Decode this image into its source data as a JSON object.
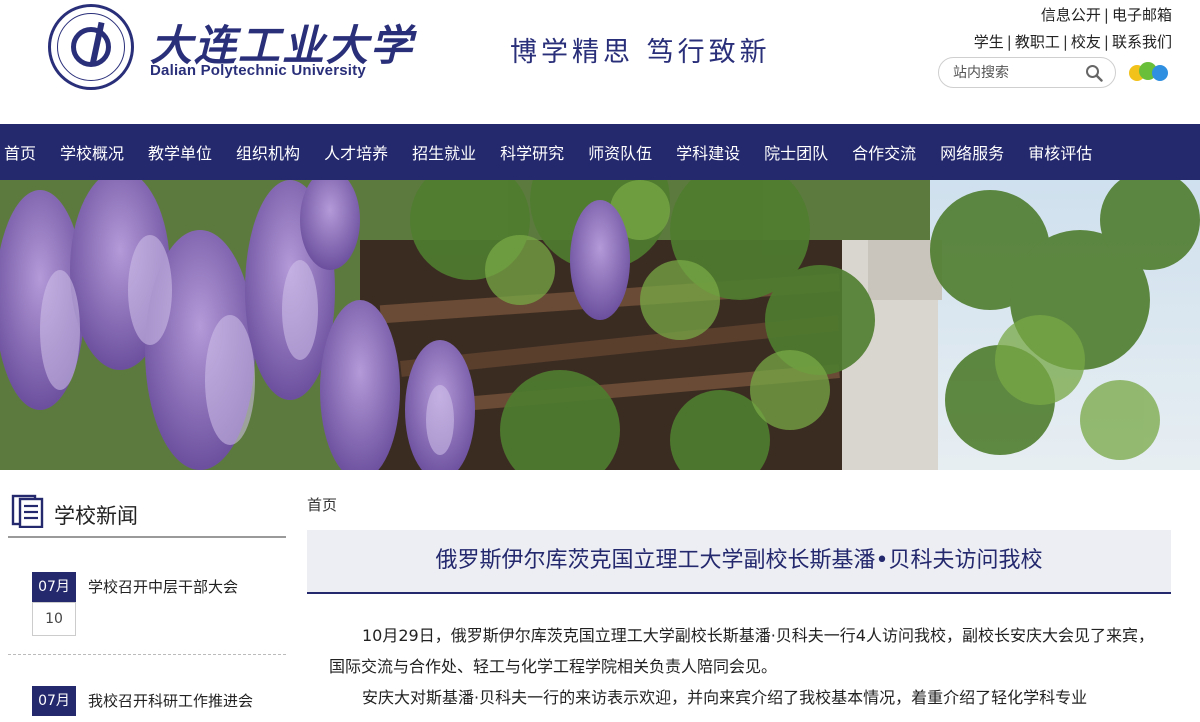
{
  "header": {
    "logo_cn": "大连工业大学",
    "logo_en": "Dalian Polytechnic University",
    "logo_seal_text": "大连工业大学 DALIAN POLYTECHNIC UNIVERSITY 1958",
    "motto": "博学精思  笃行致新",
    "top_links_row1": [
      "信息公开",
      "电子邮箱"
    ],
    "top_links_row2": [
      "学生",
      "教职工",
      "校友",
      "联系我们"
    ],
    "search_placeholder": "站内搜索"
  },
  "nav": {
    "items": [
      "首页",
      "学校概况",
      "教学单位",
      "组织机构",
      "人才培养",
      "招生就业",
      "科学研究",
      "师资队伍",
      "学科建设",
      "院士团队",
      "合作交流",
      "网络服务",
      "审核评估"
    ]
  },
  "sidebar": {
    "title": "学校新闻",
    "news": [
      {
        "month": "07月",
        "day": "10",
        "title": "学校召开中层干部大会"
      },
      {
        "month": "07月",
        "day": "",
        "title": "我校召开科研工作推进会"
      }
    ]
  },
  "main": {
    "breadcrumb": "首页",
    "article_title": "俄罗斯伊尔库茨克国立理工大学副校长斯基潘•贝科夫访问我校",
    "paragraphs": [
      "10月29日，俄罗斯伊尔库茨克国立理工大学副校长斯基潘·贝科夫一行4人访问我校，副校长安庆大会见了来宾，国际交流与合作处、轻工与化学工程学院相关负责人陪同会见。",
      "安庆大对斯基潘·贝科夫一行的来访表示欢迎，并向来宾介绍了我校基本情况，着重介绍了轻化学科专业"
    ]
  },
  "colors": {
    "primary": "#24286d",
    "title_bg": "#eceef4"
  }
}
